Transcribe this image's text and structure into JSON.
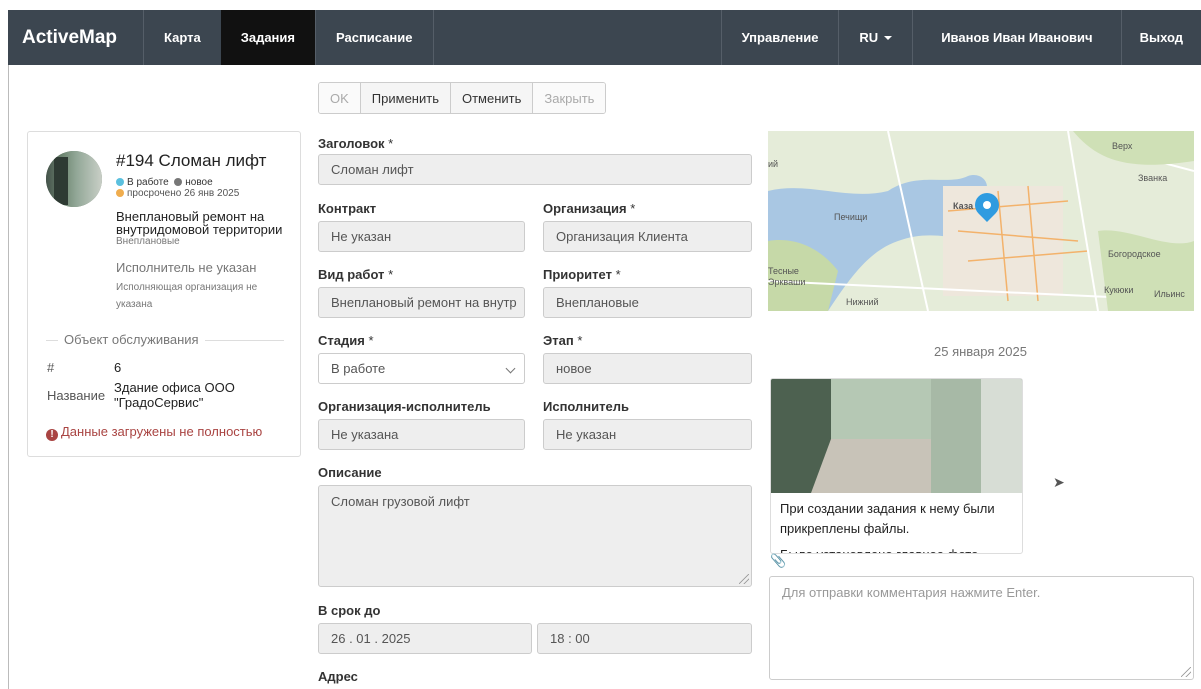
{
  "nav": {
    "brand": "ActiveMap",
    "left_items": [
      "Карта",
      "Задания",
      "Расписание"
    ],
    "right_items": [
      "Управление",
      "RU",
      "Иванов Иван Иванович",
      "Выход"
    ],
    "active": "Задания"
  },
  "toolbar": {
    "ok": "OK",
    "apply": "Применить",
    "cancel": "Отменить",
    "close": "Закрыть"
  },
  "card": {
    "title": "#194 Сломан лифт",
    "status": "В работе",
    "stage": "новое",
    "overdue": "просрочено 26 янв 2025",
    "work_type": "Внеплановый ремонт на внутридомовой территории",
    "priority": "Внеплановые",
    "executor": "Исполнитель не указан",
    "executor_org": "Исполняющая организация не указана",
    "object_legend": "Объект обслуживания",
    "object_id_key": "#",
    "object_id": "6",
    "object_name_key": "Название",
    "object_name": "Здание офиса ООО \"ГрадоСервис\"",
    "warning": "Данные загружены не полностью",
    "colors": {
      "status_dot": "#5bc0de",
      "stage_dot": "#777777",
      "overdue_dot": "#f0ad4e"
    }
  },
  "form": {
    "title_label": "Заголовок",
    "title_value": "Сломан лифт",
    "contract_label": "Контракт",
    "contract_value": "Не указан",
    "org_label": "Организация",
    "org_value": "Организация Клиента",
    "worktype_label": "Вид работ",
    "worktype_value": "Внеплановый ремонт на внутр",
    "priority_label": "Приоритет",
    "priority_value": "Внеплановые",
    "stage_label": "Стадия",
    "stage_value": "В работе",
    "step_label": "Этап",
    "step_value": "новое",
    "exec_org_label": "Организация-исполнитель",
    "exec_org_value": "Не указана",
    "executor_label": "Исполнитель",
    "executor_value": "Не указан",
    "description_label": "Описание",
    "description_value": "Сломан грузовой лифт",
    "deadline_label": "В срок до",
    "deadline_date": "26 . 01 . 2025",
    "deadline_time": "18 : 00",
    "address_label": "Адрес"
  },
  "map": {
    "labels": [
      "Печищи",
      "Каза",
      "Званка",
      "Богородское",
      "Кукюки",
      "Ильинс",
      "Тесные",
      "Эркваши",
      "Нижний",
      "Верх",
      "ий"
    ]
  },
  "feed": {
    "date": "25 января 2025",
    "photo_text_1": "При создании задания к нему были прикреплены файлы.",
    "photo_text_2": "Было установлено главное фото.",
    "comment_placeholder": "Для отправки комментария нажмите Enter."
  }
}
